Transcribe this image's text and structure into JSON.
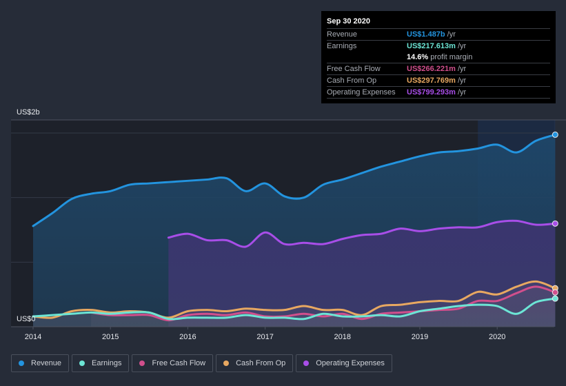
{
  "tooltip": {
    "date": "Sep 30 2020",
    "rows": [
      {
        "label": "Revenue",
        "value": "US$1.487b",
        "unit": "/yr",
        "color": "#2394df"
      },
      {
        "label": "Earnings",
        "value": "US$217.613m",
        "unit": "/yr",
        "color": "#6ce5d5"
      },
      {
        "label": "",
        "value": "14.6%",
        "unit": "profit margin",
        "color": "#ffffff"
      },
      {
        "label": "Free Cash Flow",
        "value": "US$266.221m",
        "unit": "/yr",
        "color": "#d14f8c"
      },
      {
        "label": "Cash From Op",
        "value": "US$297.769m",
        "unit": "/yr",
        "color": "#e8a861"
      },
      {
        "label": "Operating Expenses",
        "value": "US$799.293m",
        "unit": "/yr",
        "color": "#a84ee8"
      }
    ]
  },
  "legend": [
    {
      "label": "Revenue",
      "color": "#2394df"
    },
    {
      "label": "Earnings",
      "color": "#6ce5d5"
    },
    {
      "label": "Free Cash Flow",
      "color": "#d14f8c"
    },
    {
      "label": "Cash From Op",
      "color": "#e8a861"
    },
    {
      "label": "Operating Expenses",
      "color": "#a84ee8"
    }
  ],
  "chart_data": {
    "type": "area",
    "title": "",
    "xlabel": "",
    "ylabel": "",
    "y_unit": "US$ billions",
    "ylim": [
      0,
      1.5
    ],
    "y_tick_labels": [
      {
        "value": 1.5,
        "label": "US$2b"
      },
      {
        "value": 0,
        "label": "US$0"
      }
    ],
    "x_tick_labels": [
      "2014",
      "2015",
      "2016",
      "2017",
      "2018",
      "2019",
      "2020"
    ],
    "x_ticks": [
      2014,
      2015,
      2016,
      2017,
      2018,
      2019,
      2020
    ],
    "xlim": [
      2013.7,
      2020.75
    ],
    "highlight_start": 2019.75,
    "grid": true,
    "legend_position": "bottom",
    "series": [
      {
        "name": "Revenue",
        "color": "#2394df",
        "x": [
          2014.0,
          2014.25,
          2014.5,
          2014.75,
          2015.0,
          2015.25,
          2015.5,
          2015.75,
          2016.0,
          2016.25,
          2016.5,
          2016.75,
          2017.0,
          2017.25,
          2017.5,
          2017.75,
          2018.0,
          2018.25,
          2018.5,
          2018.75,
          2019.0,
          2019.25,
          2019.5,
          2019.75,
          2020.0,
          2020.25,
          2020.5,
          2020.75
        ],
        "values": [
          0.78,
          0.88,
          0.99,
          1.03,
          1.05,
          1.1,
          1.11,
          1.12,
          1.13,
          1.14,
          1.15,
          1.05,
          1.11,
          1.01,
          1.0,
          1.1,
          1.14,
          1.19,
          1.24,
          1.28,
          1.32,
          1.35,
          1.36,
          1.38,
          1.41,
          1.35,
          1.44,
          1.487
        ]
      },
      {
        "name": "Operating Expenses",
        "color": "#a84ee8",
        "x": [
          2015.75,
          2016.0,
          2016.25,
          2016.5,
          2016.75,
          2017.0,
          2017.25,
          2017.5,
          2017.75,
          2018.0,
          2018.25,
          2018.5,
          2018.75,
          2019.0,
          2019.25,
          2019.5,
          2019.75,
          2020.0,
          2020.25,
          2020.5,
          2020.75
        ],
        "values": [
          0.69,
          0.72,
          0.67,
          0.67,
          0.62,
          0.73,
          0.64,
          0.65,
          0.64,
          0.68,
          0.71,
          0.72,
          0.76,
          0.74,
          0.76,
          0.77,
          0.77,
          0.81,
          0.82,
          0.79,
          0.799
        ]
      },
      {
        "name": "Cash From Op",
        "color": "#e8a861",
        "x": [
          2014.0,
          2014.25,
          2014.5,
          2014.75,
          2015.0,
          2015.25,
          2015.5,
          2015.75,
          2016.0,
          2016.25,
          2016.5,
          2016.75,
          2017.0,
          2017.25,
          2017.5,
          2017.75,
          2018.0,
          2018.25,
          2018.5,
          2018.75,
          2019.0,
          2019.25,
          2019.5,
          2019.75,
          2020.0,
          2020.25,
          2020.5,
          2020.75
        ],
        "values": [
          0.08,
          0.07,
          0.12,
          0.13,
          0.11,
          0.12,
          0.11,
          0.07,
          0.12,
          0.13,
          0.12,
          0.14,
          0.13,
          0.13,
          0.16,
          0.13,
          0.13,
          0.09,
          0.16,
          0.17,
          0.19,
          0.2,
          0.2,
          0.27,
          0.25,
          0.31,
          0.35,
          0.298
        ]
      },
      {
        "name": "Free Cash Flow",
        "color": "#d14f8c",
        "x": [
          2014.75,
          2015.0,
          2015.25,
          2015.5,
          2015.75,
          2016.0,
          2016.25,
          2016.5,
          2016.75,
          2017.0,
          2017.25,
          2017.5,
          2017.75,
          2018.0,
          2018.25,
          2018.5,
          2018.75,
          2019.0,
          2019.25,
          2019.5,
          2019.75,
          2020.0,
          2020.25,
          2020.5,
          2020.75
        ],
        "values": [
          0.11,
          0.09,
          0.09,
          0.09,
          0.05,
          0.09,
          0.1,
          0.09,
          0.11,
          0.08,
          0.08,
          0.1,
          0.08,
          0.1,
          0.06,
          0.1,
          0.11,
          0.12,
          0.13,
          0.14,
          0.2,
          0.2,
          0.26,
          0.31,
          0.266
        ]
      },
      {
        "name": "Earnings",
        "color": "#6ce5d5",
        "x": [
          2014.0,
          2014.25,
          2014.5,
          2014.75,
          2015.0,
          2015.25,
          2015.5,
          2015.75,
          2016.0,
          2016.25,
          2016.5,
          2016.75,
          2017.0,
          2017.25,
          2017.5,
          2017.75,
          2018.0,
          2018.25,
          2018.5,
          2018.75,
          2019.0,
          2019.25,
          2019.5,
          2019.75,
          2020.0,
          2020.25,
          2020.5,
          2020.75
        ],
        "values": [
          0.08,
          0.09,
          0.1,
          0.11,
          0.1,
          0.11,
          0.11,
          0.06,
          0.07,
          0.07,
          0.07,
          0.09,
          0.07,
          0.07,
          0.06,
          0.1,
          0.08,
          0.08,
          0.09,
          0.08,
          0.12,
          0.14,
          0.16,
          0.17,
          0.16,
          0.1,
          0.19,
          0.218
        ]
      }
    ]
  }
}
